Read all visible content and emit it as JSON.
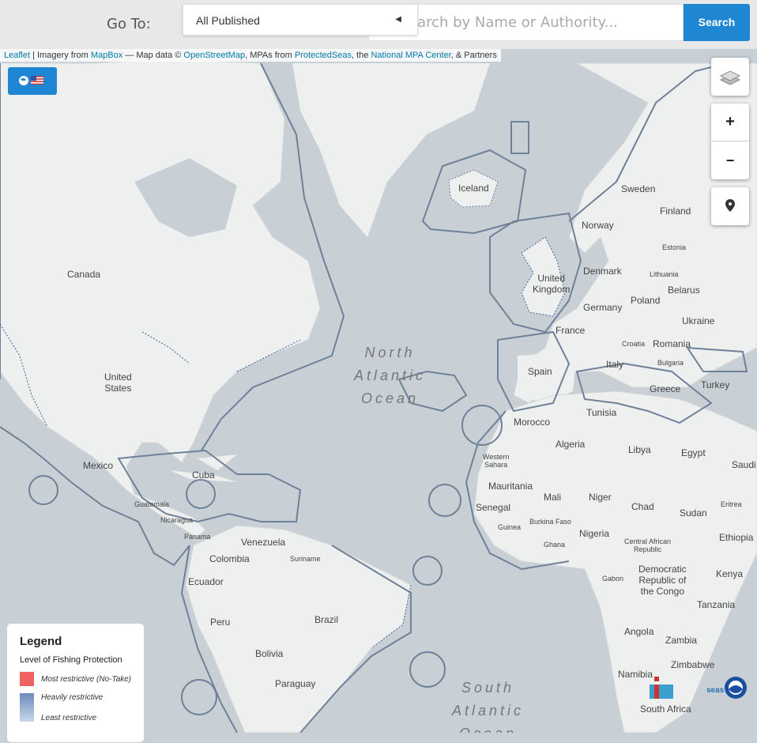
{
  "topbar": {
    "goto_label": "Go To:",
    "select_value": "All Published",
    "search_placeholder": "earch by Name or Authority...",
    "search_button": "Search"
  },
  "attribution": {
    "leaflet": "Leaflet",
    "imagery_prefix": " | Imagery from ",
    "mapbox": "MapBox",
    "mapdata_prefix": " — Map data © ",
    "osm": "OpenStreetMap",
    "mpas_prefix": ", MPAs from ",
    "protectedseas": "ProtectedSeas",
    "the": ", the ",
    "nmpa": "National MPA Center",
    "partners": ", & Partners"
  },
  "controls": {
    "zoom_in": "+",
    "zoom_out": "−"
  },
  "legend": {
    "title": "Legend",
    "subtitle": "Level of Fishing Protection",
    "items": [
      {
        "label": "Most restrictive (No-Take)",
        "color": "#f06262"
      },
      {
        "label": "Heavily restrictive",
        "color": "#6e8bbd"
      },
      {
        "label": "Least restrictive",
        "color": "#c9d6ea"
      }
    ]
  },
  "map_labels": {
    "canada": "Canada",
    "united_states": "United\nStates",
    "mexico": "Mexico",
    "cuba": "Cuba",
    "guatemala": "Guatemala",
    "nicaragua": "Nicaragua",
    "panama": "Panama",
    "venezuela": "Venezuela",
    "colombia": "Colombia",
    "suriname": "Suriname",
    "ecuador": "Ecuador",
    "peru": "Peru",
    "brazil": "Brazil",
    "bolivia": "Bolivia",
    "paraguay": "Paraguay",
    "iceland": "Iceland",
    "sweden": "Sweden",
    "finland": "Finland",
    "norway": "Norway",
    "estonia": "Estonia",
    "denmark": "Denmark",
    "lithuania": "Lithuania",
    "united_kingdom": "United\nKingdom",
    "belarus": "Belarus",
    "poland": "Poland",
    "germany": "Germany",
    "ukraine": "Ukraine",
    "france": "France",
    "croatia": "Croatia",
    "romania": "Romania",
    "italy": "Italy",
    "bulgaria": "Bulgaria",
    "spain": "Spain",
    "greece": "Greece",
    "turkey": "Turkey",
    "tunisia": "Tunisia",
    "morocco": "Morocco",
    "algeria": "Algeria",
    "libya": "Libya",
    "egypt": "Egypt",
    "saudi": "Saudi",
    "western_sahara": "Western\nSahara",
    "mauritania": "Mauritania",
    "mali": "Mali",
    "niger": "Niger",
    "chad": "Chad",
    "sudan": "Sudan",
    "eritrea": "Eritrea",
    "senegal": "Senegal",
    "guinea": "Guinea",
    "burkina_faso": "Burkina Faso",
    "nigeria": "Nigeria",
    "ethiopia": "Ethiopia",
    "ghana": "Ghana",
    "central_african_republic": "Central African\nRepublic",
    "gabon": "Gabon",
    "drc": "Democratic\nRepublic of\nthe Congo",
    "kenya": "Kenya",
    "tanzania": "Tanzania",
    "angola": "Angola",
    "zambia": "Zambia",
    "zimbabwe": "Zimbabwe",
    "namibia": "Namibia",
    "south_africa": "South Africa",
    "north_atlantic": "North\nAtlantic\nOcean",
    "south_atlantic": "South\nAtlantic\nOcean",
    "seas": "seas"
  }
}
